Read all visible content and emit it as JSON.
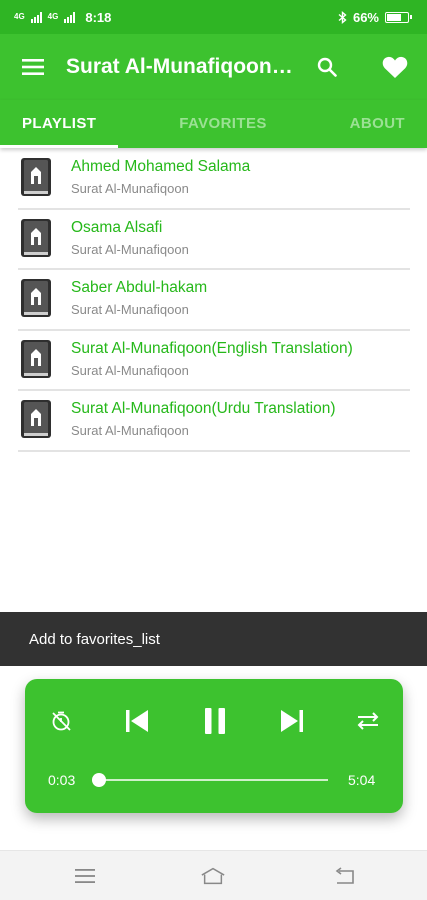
{
  "status_bar": {
    "net1": "4G",
    "net2": "4G",
    "time": "8:18",
    "battery": "66%"
  },
  "app_bar": {
    "title": "Surat Al-Munafiqoon…",
    "icons": {
      "menu": "menu-icon",
      "search": "search-icon",
      "favorite": "heart-icon"
    }
  },
  "tabs": [
    {
      "label": "PLAYLIST",
      "active": true
    },
    {
      "label": "FAVORITES",
      "active": false
    },
    {
      "label": "ABOUT",
      "active": false
    }
  ],
  "playlist": [
    {
      "title": "Ahmed Mohamed Salama",
      "subtitle": "Surat Al-Munafiqoon"
    },
    {
      "title": "Osama Alsafi",
      "subtitle": "Surat Al-Munafiqoon"
    },
    {
      "title": "Saber Abdul-hakam",
      "subtitle": "Surat Al-Munafiqoon"
    },
    {
      "title": "Surat Al-Munafiqoon(English Translation)",
      "subtitle": "Surat Al-Munafiqoon"
    },
    {
      "title": "Surat Al-Munafiqoon(Urdu Translation)",
      "subtitle": "Surat Al-Munafiqoon"
    }
  ],
  "snackbar": {
    "message": "Add to favorites_list"
  },
  "player": {
    "current_time": "0:03",
    "total_time": "5:04",
    "progress": 0.01,
    "icons": [
      "timer-off-icon",
      "skip-previous-icon",
      "pause-icon",
      "skip-next-icon",
      "repeat-icon"
    ]
  },
  "colors": {
    "primary": "#3dc22f",
    "status": "#2fb524",
    "title_green": "#26b81a",
    "subtitle_gray": "#8a8a8a",
    "snackbar": "#323232"
  }
}
